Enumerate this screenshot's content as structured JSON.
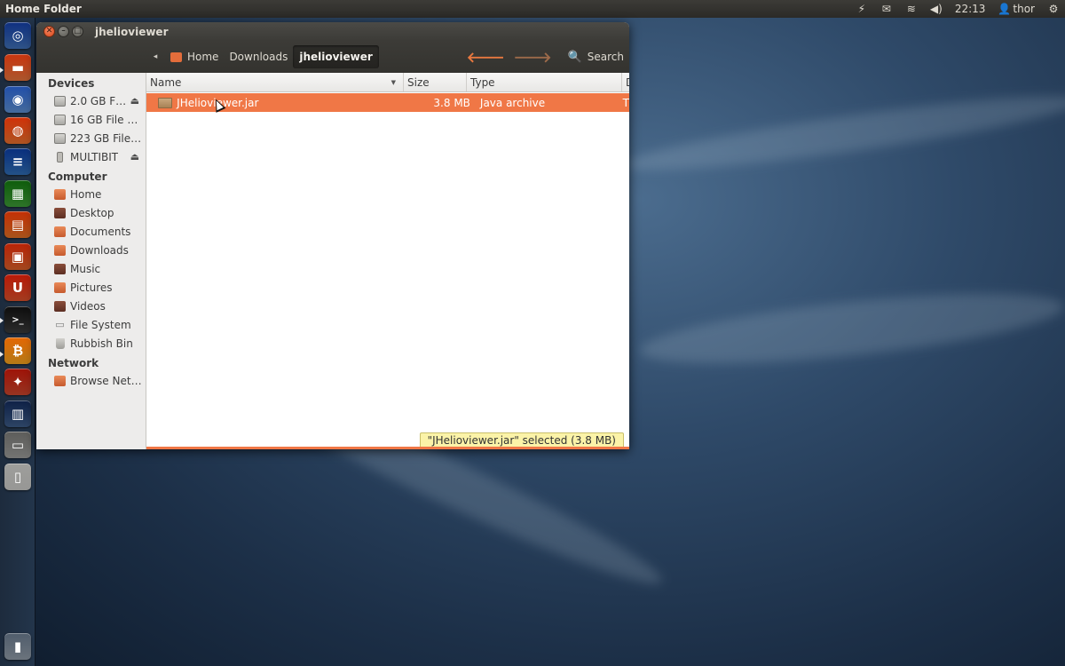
{
  "top_panel": {
    "app_title": "Home Folder",
    "time": "22:13",
    "user": "thor",
    "indicators": [
      "bolt-icon",
      "mail-icon",
      "wifi-icon",
      "volume-icon",
      "user-icon",
      "gear-icon"
    ]
  },
  "launcher": {
    "items": [
      {
        "name": "dash-home",
        "color": "#3f6fb5"
      },
      {
        "name": "files-home-folder",
        "color": "#e3743d"
      },
      {
        "name": "chromium-browser",
        "color": "#5c8ed0"
      },
      {
        "name": "firefox",
        "color": "#e7702d"
      },
      {
        "name": "libreoffice-writer",
        "color": "#2f6db3"
      },
      {
        "name": "libreoffice-calc",
        "color": "#3d9a36"
      },
      {
        "name": "libreoffice-impress",
        "color": "#e06f24"
      },
      {
        "name": "ubuntu-software-centre",
        "color": "#d95f2a"
      },
      {
        "name": "ubuntu-one",
        "color": "#d9502b"
      },
      {
        "name": "terminal",
        "color": "#3a3a3a"
      },
      {
        "name": "bitcoin",
        "color": "#f1a21e"
      },
      {
        "name": "system-settings",
        "color": "#c9452c"
      },
      {
        "name": "workspace-switcher",
        "color": "#3c5b86"
      },
      {
        "name": "disk-drive",
        "color": "#9a9a98"
      },
      {
        "name": "usb-drive",
        "color": "#c9c9c7"
      },
      {
        "name": "trash",
        "color": "#8f9aa6"
      }
    ]
  },
  "window": {
    "title": "jhelioviewer",
    "breadcrumbs": [
      "Home",
      "Downloads",
      "jhelioviewer"
    ],
    "search_label": "Search"
  },
  "sidebar": {
    "devices_heading": "Devices",
    "devices": [
      "2.0 GB F…",
      "16 GB File sy…",
      "223 GB File s…",
      "MULTIBIT"
    ],
    "computer_heading": "Computer",
    "computer": [
      "Home",
      "Desktop",
      "Documents",
      "Downloads",
      "Music",
      "Pictures",
      "Videos",
      "File System",
      "Rubbish Bin"
    ],
    "network_heading": "Network",
    "network": [
      "Browse Net…"
    ]
  },
  "columns": {
    "name": "Name",
    "size": "Size",
    "type": "Type",
    "date": "D"
  },
  "files": [
    {
      "name": "JHelioviewer.jar",
      "size": "3.8 MB",
      "type": "Java archive",
      "date": "T"
    }
  ],
  "status": "\"JHelioviewer.jar\" selected (3.8 MB)",
  "colors": {
    "accent": "#f07746",
    "panel": "#3c3b37",
    "status_bg": "#fbf3a8"
  }
}
